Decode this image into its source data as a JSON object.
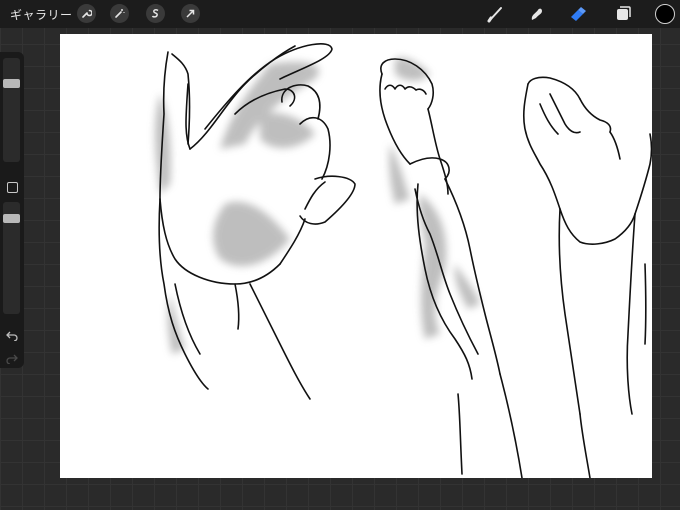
{
  "topbar": {
    "gallery_label": "ギャラリー",
    "left_tools": [
      "wrench-icon",
      "magic-wand-icon",
      "selection-icon",
      "transform-arrow-icon"
    ],
    "right_tools": [
      "brush-icon",
      "smudge-icon",
      "eraser-icon",
      "layers-icon"
    ],
    "active_tool": "eraser-icon",
    "accent_color": "#2f7cf6",
    "current_color": "#000000"
  },
  "sidebar": {
    "brush_size_level": 0.78,
    "opacity_level": 0.88,
    "buttons": [
      "modify-button",
      "undo-icon",
      "redo-icon"
    ]
  },
  "canvas": {
    "background": "#ffffff",
    "content": "sketch-of-hands"
  }
}
